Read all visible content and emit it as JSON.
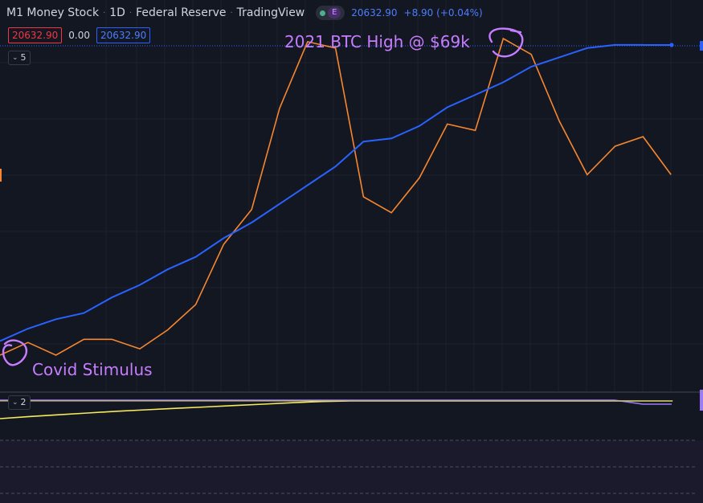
{
  "header": {
    "title": "M1 Money Stock",
    "interval": "1D",
    "source": "Federal Reserve",
    "platform": "TradingView",
    "status_e": "E",
    "last_price": "20632.90",
    "change": "+8.90 (+0.04%)"
  },
  "price_row": {
    "sell": "20632.90",
    "spread": "0.00",
    "buy": "20632.90"
  },
  "panes": {
    "main_collapse": "5",
    "sub_collapse": "2"
  },
  "annotations": {
    "btc_high": "2021 BTC High @ $69k",
    "covid": "Covid Stimulus"
  },
  "colors": {
    "background": "#131722",
    "m1_line": "#2962ff",
    "btc_line": "#f7862f",
    "annotation": "#c77dff",
    "yellow_line": "#f5e960",
    "purple_line": "#9c7cf4"
  },
  "chart_data": {
    "type": "line",
    "grid": true,
    "series": [
      {
        "name": "M1 Money Stock",
        "x": [
          0,
          1,
          2,
          3,
          4,
          5,
          6,
          7,
          8,
          9,
          10,
          11,
          12,
          13,
          14,
          15,
          16,
          17,
          18,
          19,
          20,
          21,
          22,
          23
        ],
        "values": [
          0.04,
          0.08,
          0.11,
          0.13,
          0.18,
          0.22,
          0.27,
          0.31,
          0.37,
          0.42,
          0.48,
          0.54,
          0.6,
          0.68,
          0.69,
          0.73,
          0.79,
          0.83,
          0.87,
          0.92,
          0.95,
          0.98,
          0.99,
          0.99
        ],
        "ext": [
          0.995,
          0.995,
          0.995
        ]
      },
      {
        "name": "BTC",
        "x": [
          0,
          1,
          2,
          3,
          4,
          5,
          6,
          7,
          8,
          9,
          10,
          11,
          12,
          13,
          14,
          15,
          16,
          17,
          18,
          19,
          20,
          21,
          22,
          23,
          24
        ],
        "values": [
          0.0,
          0.04,
          0.0,
          0.05,
          0.05,
          0.02,
          0.08,
          0.16,
          0.35,
          0.46,
          0.78,
          0.99,
          0.97,
          0.5,
          0.45,
          0.56,
          0.73,
          0.71,
          1.0,
          0.95,
          0.74,
          0.57,
          0.66,
          0.69,
          0.57
        ]
      }
    ],
    "sub_series": [
      {
        "name": "yellow",
        "x": [
          0,
          1,
          2,
          3,
          4,
          5,
          6,
          7,
          8,
          9,
          10,
          11,
          12,
          13,
          14,
          15,
          16,
          17,
          18,
          19,
          20,
          21,
          22,
          23
        ],
        "values": [
          0.0,
          0.12,
          0.22,
          0.32,
          0.42,
          0.5,
          0.58,
          0.66,
          0.74,
          0.82,
          0.9,
          0.97,
          1.0,
          1.0,
          1.0,
          1.0,
          1.0,
          1.0,
          1.0,
          1.0,
          1.0,
          1.0,
          1.0,
          1.0
        ]
      },
      {
        "name": "purple",
        "x": [
          0,
          1,
          2,
          3,
          4,
          5,
          6,
          7,
          8,
          9,
          10,
          11,
          12,
          13,
          14,
          15,
          16,
          17,
          18,
          19,
          20,
          21,
          22,
          23
        ],
        "values": [
          1,
          1,
          1,
          1,
          1,
          1,
          1,
          1,
          1,
          1,
          1,
          1,
          1,
          1,
          1,
          1,
          1,
          1,
          1,
          1,
          1,
          0.85,
          0.85,
          0.85
        ]
      }
    ]
  }
}
